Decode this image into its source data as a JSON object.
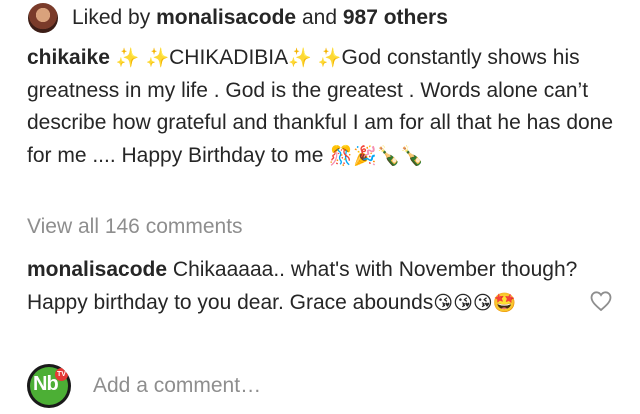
{
  "likes": {
    "prefix": "Liked by",
    "user": "monalisacode",
    "connector": "and",
    "others": "987 others"
  },
  "post": {
    "username": "chikaike",
    "emoji_sparkles": "✨ ✨",
    "mid_text": "CHIKADIBIA",
    "body": "God constantly shows his greatness in my life . God is the greatest . Words alone can’t describe how grateful and thankful I am for all that he has done for me .... Happy Birthday to me",
    "end_emojis": "🎊🎉🍾🍾"
  },
  "comments": {
    "view_all": "View all 146 comments",
    "items": [
      {
        "username": "monalisacode",
        "text": "Chikaaaaa.. what's with November though? Happy birthday to you dear. Grace abounds",
        "emojis": "😘😘😘🤩"
      }
    ]
  },
  "add_comment": {
    "placeholder": "Add a comment…",
    "avatar_text": "Nb",
    "avatar_badge": "TV"
  },
  "icons": {
    "like": "heart-icon",
    "avatar": "user-avatar"
  },
  "colors": {
    "text": "#262626",
    "muted": "#8e8e8e",
    "logo_green": "#4caf35"
  }
}
